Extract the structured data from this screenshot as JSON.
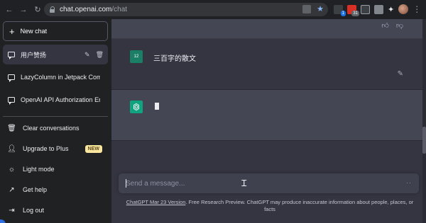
{
  "browser": {
    "back_icon": "back-arrow-icon",
    "forward_icon": "forward-arrow-icon",
    "reload_icon": "reload-icon",
    "url_host": "chat.openai.com",
    "url_path": "/chat",
    "extension_badges": [
      "1",
      "31"
    ]
  },
  "sidebar": {
    "new_chat_label": "New chat",
    "conversations": [
      {
        "label": "用户赞扬",
        "active": true
      },
      {
        "label": "LazyColumn in Jetpack Com",
        "active": false
      },
      {
        "label": "OpenAI API Authorization Err",
        "active": false
      }
    ],
    "menu": [
      {
        "label": "Clear conversations",
        "icon": "trash-icon"
      },
      {
        "label": "Upgrade to Plus",
        "icon": "user-icon",
        "badge": "NEW"
      },
      {
        "label": "Light mode",
        "icon": "sun-icon"
      },
      {
        "label": "Get help",
        "icon": "external-link-icon"
      },
      {
        "label": "Log out",
        "icon": "logout-icon"
      }
    ]
  },
  "chat": {
    "user_avatar_text": "12",
    "user_message": "三百字的散文",
    "input_placeholder": "Send a message...",
    "footer_link": "ChatGPT Mar 23 Version",
    "footer_text": ". Free Research Preview. ChatGPT may produce inaccurate information about people, places, or facts"
  },
  "colors": {
    "sidebar_bg": "#202123",
    "main_bg": "#343541",
    "bot_bg": "#444654",
    "accent": "#10a37f",
    "badge_bg": "#fae69e"
  }
}
